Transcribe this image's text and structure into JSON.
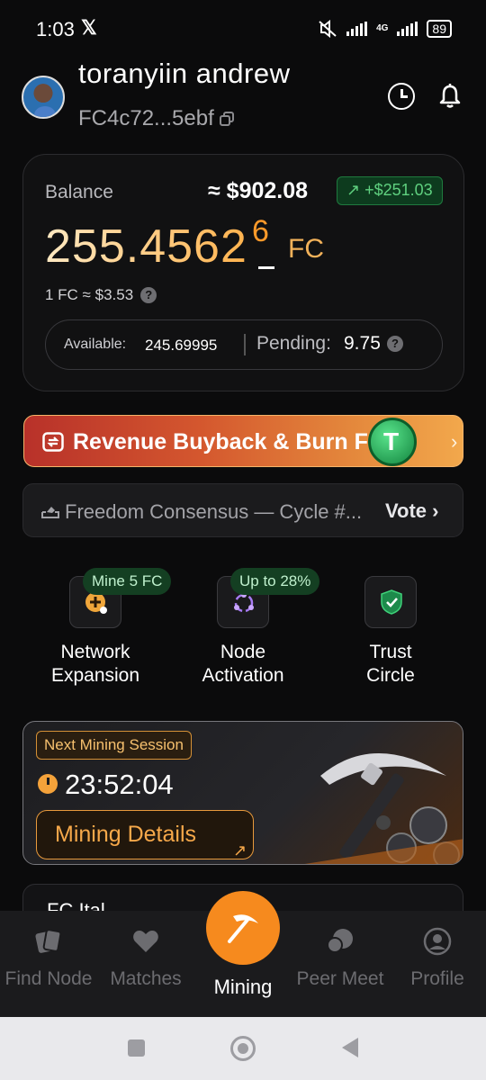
{
  "statusbar": {
    "time": "1:03",
    "x_glyph": "𝕏",
    "network": "4G",
    "battery": "89",
    "icons": [
      "x-icon",
      "mute-vibrate-icon",
      "signal-icon",
      "4g-signal-icon",
      "battery-icon"
    ]
  },
  "header": {
    "username": "toranyiin andrew",
    "wallet": "FC4c72...5ebf",
    "icons": [
      "avatar",
      "copy-icon",
      "history-clock-icon",
      "bell-icon"
    ]
  },
  "balance": {
    "label": "Balance",
    "usd": "≈ $902.08",
    "gain": "+$251.03",
    "gain_arrow": "↗",
    "amount": "255.4562",
    "amount_sup": "6",
    "unit": "FC",
    "rate": "1 FC ≈ $3.53",
    "available_label": "Available:",
    "available_value": "245.69995",
    "pending_label": "Pending:",
    "pending_value": "9.75",
    "help_glyph": "?",
    "colors": {
      "amount": "#ffb24d",
      "gain": "#5fd07f"
    }
  },
  "banner": {
    "label": "Revenue Buyback & Burn FC",
    "coin_letter": "T",
    "chevron": "›"
  },
  "consensus": {
    "text": "Freedom Consensus — Cycle #...",
    "action": "Vote",
    "chevron": "›"
  },
  "features": [
    {
      "badge": "Mine 5 FC",
      "label_line1": "Network",
      "label_line2": "Expansion",
      "icon": "network-expansion-icon"
    },
    {
      "badge": "Up to 28%",
      "label_line1": "Node",
      "label_line2": "Activation",
      "icon": "node-activation-icon"
    },
    {
      "badge": "",
      "label_line1": "Trust",
      "label_line2": "Circle",
      "icon": "trust-shield-icon"
    }
  ],
  "mining_card": {
    "tag": "Next Mining Session",
    "countdown": "23:52:04",
    "button": "Mining Details",
    "button_arrow": "↗"
  },
  "partial_card": {
    "text": "FC Ital"
  },
  "bottom_nav": {
    "items": [
      {
        "label": "Find Node",
        "icon": "cards-icon"
      },
      {
        "label": "Matches",
        "icon": "heart-icon"
      },
      {
        "label": "Mining",
        "icon": "pickaxe-icon"
      },
      {
        "label": "Peer Meet",
        "icon": "chat-bubbles-icon"
      },
      {
        "label": "Profile",
        "icon": "profile-icon"
      }
    ],
    "active_color": "#f68a1e"
  }
}
